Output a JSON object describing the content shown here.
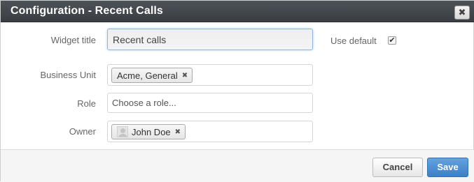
{
  "dialog": {
    "title": "Configuration - Recent Calls",
    "close_glyph": "✖"
  },
  "form": {
    "widget_title": {
      "label": "Widget title",
      "value": "Recent calls"
    },
    "use_default": {
      "label": "Use default",
      "checked": true,
      "check_glyph": "✔"
    },
    "business_unit": {
      "label": "Business Unit",
      "chips": [
        "Acme, General"
      ]
    },
    "role": {
      "label": "Role",
      "placeholder": "Choose a role..."
    },
    "owner": {
      "label": "Owner",
      "chips": [
        "John Doe"
      ]
    },
    "chip_remove_glyph": "✖"
  },
  "footer": {
    "cancel_label": "Cancel",
    "save_label": "Save"
  },
  "colors": {
    "titlebar": "#3f4348",
    "save_button": "#4a8bd2",
    "focus_border": "#8fb5e0"
  }
}
